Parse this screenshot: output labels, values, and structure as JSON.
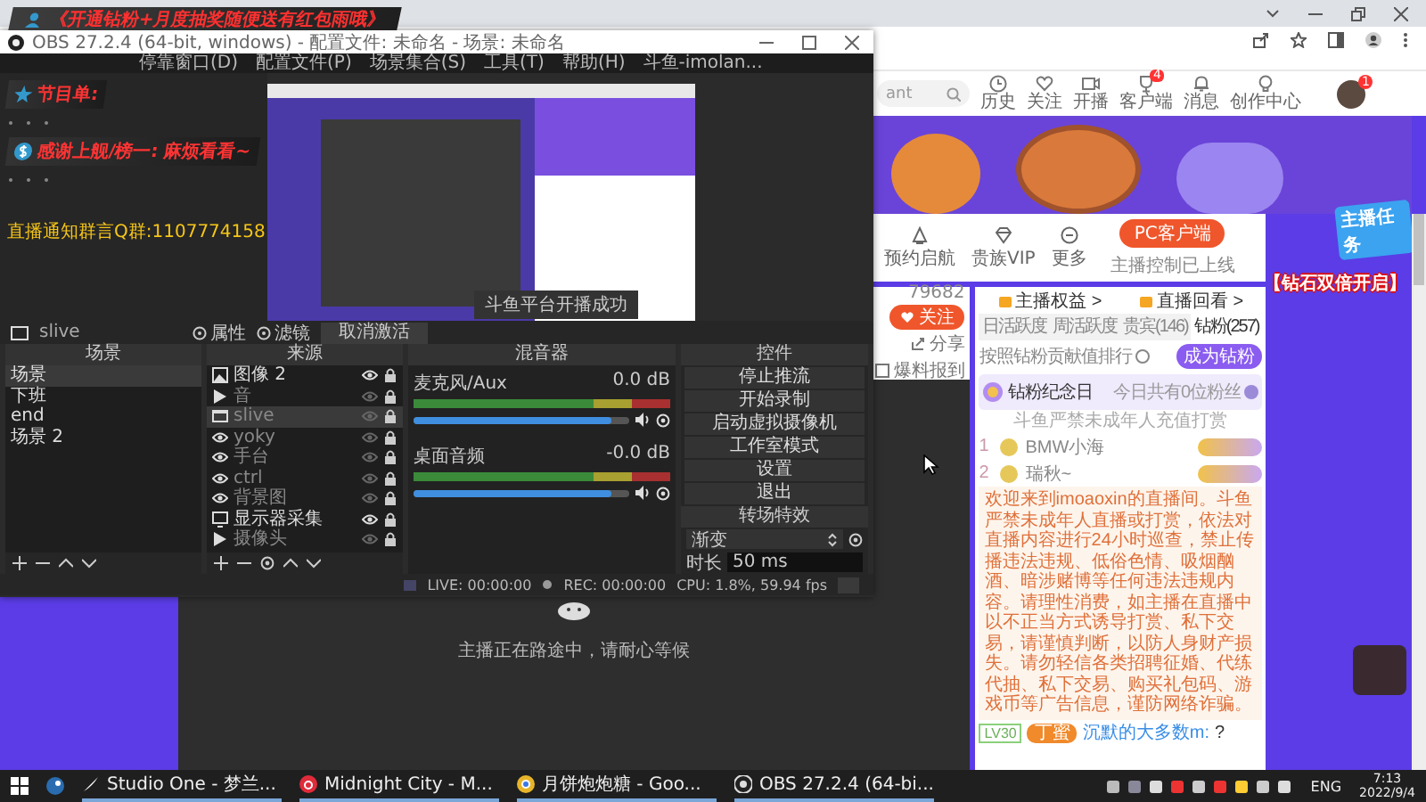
{
  "overlay_banner": "《开通钻粉+月度抽奖随便送有红包雨哦》",
  "obs": {
    "title": "OBS 27.2.4 (64-bit, windows) - 配置文件: 未命名 - 场景: 未命名",
    "menu": [
      "停靠窗口(D)",
      "配置文件(P)",
      "场景集合(S)",
      "工具(T)",
      "帮助(H)",
      "斗鱼-imolan..."
    ],
    "program_label": "节目单:",
    "thanks_label": "感谢上舰/榜一: 麻烦看看~",
    "group_notice": "直播通知群言Q群:1107774158",
    "toast": "斗鱼平台开播成功",
    "source_bar": {
      "source": "slive",
      "buttons": [
        "属性",
        "滤镜"
      ],
      "deactivate": "取消激活"
    },
    "scenes": {
      "title": "场景",
      "items": [
        {
          "label": "场景",
          "selected": true
        },
        {
          "label": "下班",
          "selected": false
        },
        {
          "label": "end",
          "selected": false
        },
        {
          "label": "场景 2",
          "selected": false
        }
      ]
    },
    "sources": {
      "title": "来源",
      "items": [
        {
          "label": "图像 2",
          "kind": "image",
          "visible": true,
          "selected": false
        },
        {
          "label": "音",
          "kind": "media",
          "visible": false,
          "selected": false
        },
        {
          "label": "slive",
          "kind": "capture",
          "visible": false,
          "selected": true
        },
        {
          "label": "yoky",
          "kind": "group",
          "visible": false,
          "selected": false
        },
        {
          "label": "手台",
          "kind": "group",
          "visible": false,
          "selected": false
        },
        {
          "label": "ctrl",
          "kind": "group",
          "visible": false,
          "selected": false
        },
        {
          "label": "背景图",
          "kind": "group",
          "visible": false,
          "selected": false
        },
        {
          "label": "显示器采集",
          "kind": "monitor",
          "visible": true,
          "selected": false
        },
        {
          "label": "摄像头",
          "kind": "media",
          "visible": false,
          "selected": false
        }
      ]
    },
    "mixer": {
      "title": "混音器",
      "channels": [
        {
          "name": "麦克风/Aux",
          "reading": "0.0 dB",
          "level": 0.92
        },
        {
          "name": "桌面音频",
          "reading": "-0.0 dB",
          "level": 0.92
        }
      ]
    },
    "controls": {
      "title": "控件",
      "buttons": [
        "停止推流",
        "开始录制",
        "启动虚拟摄像机",
        "工作室模式",
        "设置",
        "退出"
      ]
    },
    "transitions": {
      "title": "转场特效",
      "type": "渐变",
      "duration_label": "时长",
      "duration": "50 ms"
    },
    "status": {
      "live": "LIVE: 00:00:00",
      "rec": "REC: 00:00:00",
      "cpu": "CPU: 1.8%, 59.94 fps"
    }
  },
  "page": {
    "search_value": "ant",
    "nav": [
      {
        "label": "历史"
      },
      {
        "label": "关注"
      },
      {
        "label": "开播"
      },
      {
        "label": "客户端",
        "badge": "4"
      },
      {
        "label": "消息"
      },
      {
        "label": "创作中心"
      }
    ],
    "avatar_badge": "1",
    "actions": [
      "预约启航",
      "贵族VIP",
      "更多"
    ],
    "pc_client": "PC客户端",
    "pc_note": "主播控制已上线",
    "follower_count": "79682",
    "follow": "关注",
    "share": "分享",
    "report": "爆料报到",
    "video_notice": "主播正在路途中，请耐心等候",
    "panel": {
      "links": [
        "主播权益 >",
        "直播回看 >"
      ],
      "tabs": [
        {
          "label": "日活跃度",
          "selected": false
        },
        {
          "label": "周活跃度",
          "selected": false
        },
        {
          "label": "贵宾(146)",
          "selected": false
        },
        {
          "label": "钻粉(257)",
          "selected": true
        }
      ],
      "rank_hint": "按照钻粉贡献值排行",
      "become": "成为钻粉",
      "anniversary": "钻粉纪念日",
      "today": "今日共有0位粉丝",
      "minor_note": "斗鱼严禁未成年人充值打赏",
      "ranks": [
        {
          "rank": "1",
          "name": "BMW小海"
        },
        {
          "rank": "2",
          "name": "瑞秋~"
        }
      ],
      "notice": "欢迎来到imoaoxin的直播间。斗鱼严禁未成年人直播或打赏，依法对直播内容进行24小时巡查，禁止传播违法违规、低俗色情、吸烟酗酒、暗涉赌博等任何违法违规内容。请理性消费，如主播在直播中以不正当方式诱导打赏、私下交易，请谨慎判断，以防人身财产损失。请勿轻信各类招聘征婚、代练代抽、私下交易、购买礼包码、游戏币等广告信息，谨防网络诈骗。",
      "chat": [
        {
          "level": "LV30",
          "badge": "丁蜜",
          "user": "沉默的大多数m:",
          "message": "?"
        }
      ]
    },
    "task_badge": "主播任务",
    "promo": "【钻石双倍开启】"
  },
  "taskbar": {
    "apps": [
      {
        "label": "Studio One - 梦兰..."
      },
      {
        "label": "Midnight City - M..."
      },
      {
        "label": "月饼炮炮糖 - Goo..."
      },
      {
        "label": "OBS 27.2.4 (64-bi..."
      }
    ],
    "lang": "ENG",
    "time": "7:13",
    "date": "2022/9/4"
  }
}
